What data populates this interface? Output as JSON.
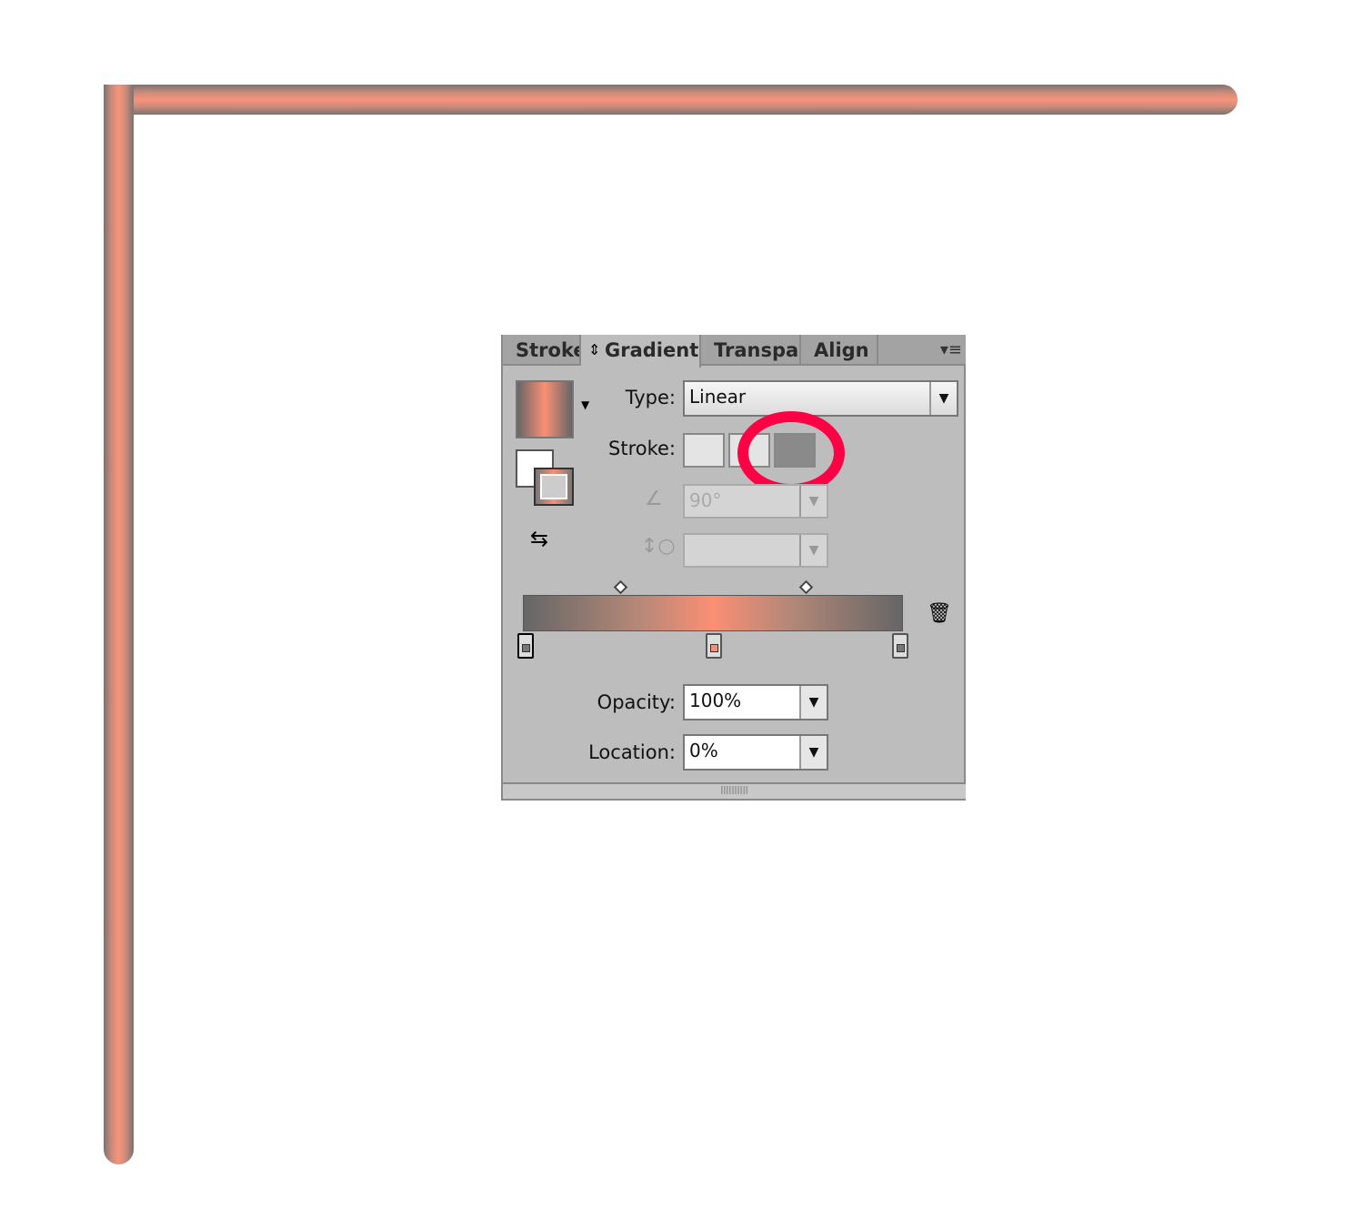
{
  "tabs": [
    {
      "label": "Stroke"
    },
    {
      "label": "Gradient",
      "active": true
    },
    {
      "label": "Transpar"
    },
    {
      "label": "Align"
    }
  ],
  "gradient": {
    "type_label": "Type:",
    "type_value": "Linear",
    "stroke_label": "Stroke:",
    "angle_value": "90°",
    "aspect_value": "",
    "opacity_label": "Opacity:",
    "opacity_value": "100%",
    "location_label": "Location:",
    "location_value": "0%",
    "stops": [
      {
        "location": 0,
        "color": "#666666",
        "selected": true
      },
      {
        "location": 50,
        "color": "#fa8f74"
      },
      {
        "location": 100,
        "color": "#666666"
      }
    ],
    "midpoints": [
      25,
      75
    ],
    "selected_stroke_option": "apply gradient across stroke"
  },
  "colors": {
    "accent": "#fa8f74",
    "edge": "#666666",
    "highlight_circle": "#ff0044"
  }
}
